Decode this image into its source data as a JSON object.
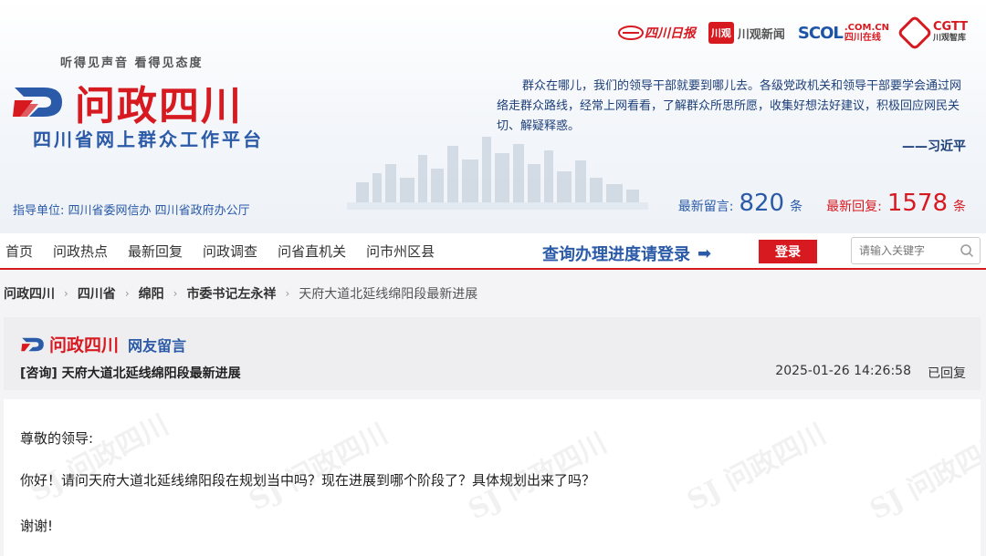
{
  "header": {
    "slogan": "听得见声音 看得见态度",
    "logo_text": "问政四川",
    "logo_sub": "四川省网上群众工作平台",
    "guide": "指导单位: 四川省委网信办 四川省政府办公厅",
    "partners": {
      "scdaily": "四川日报",
      "cg_box": "川观",
      "cg_text": "川观新闻",
      "scol_main": "SCOL",
      "scol_domain": ".COM.CN",
      "scol_cn": "四川在线",
      "cgtt_main": "CGTT",
      "cgtt_sub": "川观智库"
    },
    "quote": "群众在哪儿，我们的领导干部就要到哪儿去。各级党政机关和领导干部要学会通过网络走群众路线，经常上网看看，了解群众所思所愿，收集好想法好建议，积极回应网民关切、解疑释惑。",
    "quote_author": "——习近平",
    "stats": {
      "latest_msg_label": "最新留言:",
      "latest_msg_value": "820",
      "latest_reply_label": "最新回复:",
      "latest_reply_value": "1578",
      "unit": "条"
    }
  },
  "nav": {
    "items": [
      "首页",
      "问政热点",
      "最新回复",
      "问政调查",
      "问省直机关",
      "问市州区县"
    ],
    "login_hint": "查询办理进度请登录",
    "login_button": "登录",
    "search_placeholder": "请输入关键字"
  },
  "breadcrumb": [
    "问政四川",
    "四川省",
    "绵阳",
    "市委书记左永祥",
    "天府大道北延线绵阳段最新进展"
  ],
  "message": {
    "logo_name": "问政四川",
    "logo_tag": "网友留言",
    "title": "[咨询] 天府大道北延线绵阳段最新进展",
    "date": "2025-01-26 14:26:58",
    "status": "已回复",
    "body": [
      "尊敬的领导:",
      "你好！请问天府大道北延线绵阳段在规划当中吗？现在进展到哪个阶段了？具体规划出来了吗？",
      "谢谢!"
    ]
  },
  "colors": {
    "brand_red": "#d71920",
    "brand_blue": "#2a5aa8"
  }
}
